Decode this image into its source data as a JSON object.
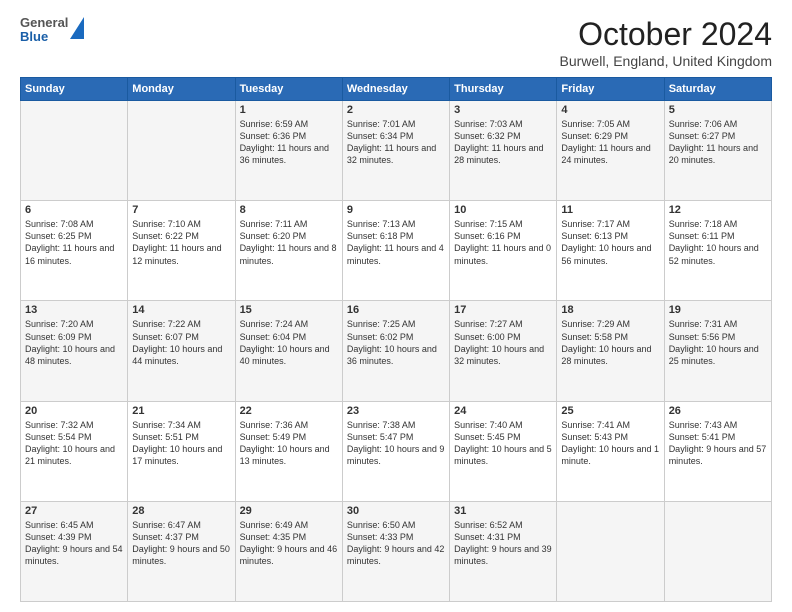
{
  "header": {
    "logo": {
      "general": "General",
      "blue": "Blue"
    },
    "title": "October 2024",
    "location": "Burwell, England, United Kingdom"
  },
  "weekdays": [
    "Sunday",
    "Monday",
    "Tuesday",
    "Wednesday",
    "Thursday",
    "Friday",
    "Saturday"
  ],
  "weeks": [
    [
      {
        "day": "",
        "info": ""
      },
      {
        "day": "",
        "info": ""
      },
      {
        "day": "1",
        "info": "Sunrise: 6:59 AM\nSunset: 6:36 PM\nDaylight: 11 hours and 36 minutes."
      },
      {
        "day": "2",
        "info": "Sunrise: 7:01 AM\nSunset: 6:34 PM\nDaylight: 11 hours and 32 minutes."
      },
      {
        "day": "3",
        "info": "Sunrise: 7:03 AM\nSunset: 6:32 PM\nDaylight: 11 hours and 28 minutes."
      },
      {
        "day": "4",
        "info": "Sunrise: 7:05 AM\nSunset: 6:29 PM\nDaylight: 11 hours and 24 minutes."
      },
      {
        "day": "5",
        "info": "Sunrise: 7:06 AM\nSunset: 6:27 PM\nDaylight: 11 hours and 20 minutes."
      }
    ],
    [
      {
        "day": "6",
        "info": "Sunrise: 7:08 AM\nSunset: 6:25 PM\nDaylight: 11 hours and 16 minutes."
      },
      {
        "day": "7",
        "info": "Sunrise: 7:10 AM\nSunset: 6:22 PM\nDaylight: 11 hours and 12 minutes."
      },
      {
        "day": "8",
        "info": "Sunrise: 7:11 AM\nSunset: 6:20 PM\nDaylight: 11 hours and 8 minutes."
      },
      {
        "day": "9",
        "info": "Sunrise: 7:13 AM\nSunset: 6:18 PM\nDaylight: 11 hours and 4 minutes."
      },
      {
        "day": "10",
        "info": "Sunrise: 7:15 AM\nSunset: 6:16 PM\nDaylight: 11 hours and 0 minutes."
      },
      {
        "day": "11",
        "info": "Sunrise: 7:17 AM\nSunset: 6:13 PM\nDaylight: 10 hours and 56 minutes."
      },
      {
        "day": "12",
        "info": "Sunrise: 7:18 AM\nSunset: 6:11 PM\nDaylight: 10 hours and 52 minutes."
      }
    ],
    [
      {
        "day": "13",
        "info": "Sunrise: 7:20 AM\nSunset: 6:09 PM\nDaylight: 10 hours and 48 minutes."
      },
      {
        "day": "14",
        "info": "Sunrise: 7:22 AM\nSunset: 6:07 PM\nDaylight: 10 hours and 44 minutes."
      },
      {
        "day": "15",
        "info": "Sunrise: 7:24 AM\nSunset: 6:04 PM\nDaylight: 10 hours and 40 minutes."
      },
      {
        "day": "16",
        "info": "Sunrise: 7:25 AM\nSunset: 6:02 PM\nDaylight: 10 hours and 36 minutes."
      },
      {
        "day": "17",
        "info": "Sunrise: 7:27 AM\nSunset: 6:00 PM\nDaylight: 10 hours and 32 minutes."
      },
      {
        "day": "18",
        "info": "Sunrise: 7:29 AM\nSunset: 5:58 PM\nDaylight: 10 hours and 28 minutes."
      },
      {
        "day": "19",
        "info": "Sunrise: 7:31 AM\nSunset: 5:56 PM\nDaylight: 10 hours and 25 minutes."
      }
    ],
    [
      {
        "day": "20",
        "info": "Sunrise: 7:32 AM\nSunset: 5:54 PM\nDaylight: 10 hours and 21 minutes."
      },
      {
        "day": "21",
        "info": "Sunrise: 7:34 AM\nSunset: 5:51 PM\nDaylight: 10 hours and 17 minutes."
      },
      {
        "day": "22",
        "info": "Sunrise: 7:36 AM\nSunset: 5:49 PM\nDaylight: 10 hours and 13 minutes."
      },
      {
        "day": "23",
        "info": "Sunrise: 7:38 AM\nSunset: 5:47 PM\nDaylight: 10 hours and 9 minutes."
      },
      {
        "day": "24",
        "info": "Sunrise: 7:40 AM\nSunset: 5:45 PM\nDaylight: 10 hours and 5 minutes."
      },
      {
        "day": "25",
        "info": "Sunrise: 7:41 AM\nSunset: 5:43 PM\nDaylight: 10 hours and 1 minute."
      },
      {
        "day": "26",
        "info": "Sunrise: 7:43 AM\nSunset: 5:41 PM\nDaylight: 9 hours and 57 minutes."
      }
    ],
    [
      {
        "day": "27",
        "info": "Sunrise: 6:45 AM\nSunset: 4:39 PM\nDaylight: 9 hours and 54 minutes."
      },
      {
        "day": "28",
        "info": "Sunrise: 6:47 AM\nSunset: 4:37 PM\nDaylight: 9 hours and 50 minutes."
      },
      {
        "day": "29",
        "info": "Sunrise: 6:49 AM\nSunset: 4:35 PM\nDaylight: 9 hours and 46 minutes."
      },
      {
        "day": "30",
        "info": "Sunrise: 6:50 AM\nSunset: 4:33 PM\nDaylight: 9 hours and 42 minutes."
      },
      {
        "day": "31",
        "info": "Sunrise: 6:52 AM\nSunset: 4:31 PM\nDaylight: 9 hours and 39 minutes."
      },
      {
        "day": "",
        "info": ""
      },
      {
        "day": "",
        "info": ""
      }
    ]
  ]
}
